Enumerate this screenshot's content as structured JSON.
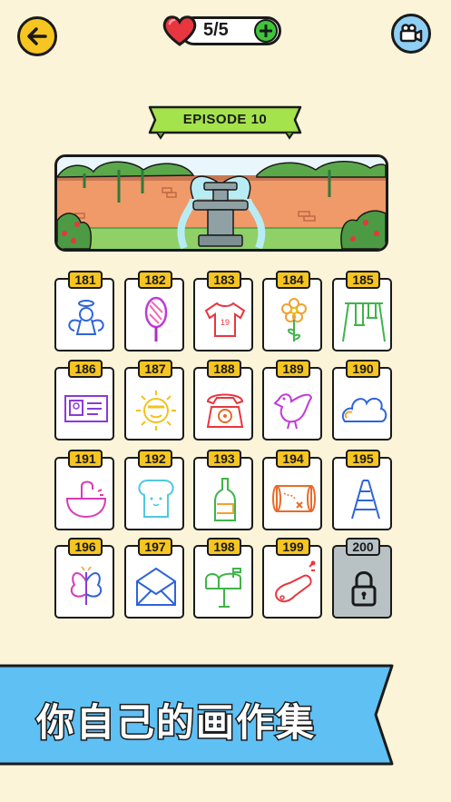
{
  "header": {
    "lives_text": "5/5",
    "lives_current": 5,
    "lives_max": 5
  },
  "episode": {
    "label": "EPISODE 10"
  },
  "levels": [
    {
      "number": "181",
      "icon": "angel-icon",
      "locked": false
    },
    {
      "number": "182",
      "icon": "popsicle-icon",
      "locked": false
    },
    {
      "number": "183",
      "icon": "tshirt-icon",
      "locked": false
    },
    {
      "number": "184",
      "icon": "flower-icon",
      "locked": false
    },
    {
      "number": "185",
      "icon": "swing-icon",
      "locked": false
    },
    {
      "number": "186",
      "icon": "id-card-icon",
      "locked": false
    },
    {
      "number": "187",
      "icon": "sun-icon",
      "locked": false
    },
    {
      "number": "188",
      "icon": "telephone-icon",
      "locked": false
    },
    {
      "number": "189",
      "icon": "bird-icon",
      "locked": false
    },
    {
      "number": "190",
      "icon": "cloud-icon",
      "locked": false
    },
    {
      "number": "191",
      "icon": "sink-icon",
      "locked": false
    },
    {
      "number": "192",
      "icon": "toast-icon",
      "locked": false
    },
    {
      "number": "193",
      "icon": "bottle-icon",
      "locked": false
    },
    {
      "number": "194",
      "icon": "treasure-map-icon",
      "locked": false
    },
    {
      "number": "195",
      "icon": "ladder-icon",
      "locked": false
    },
    {
      "number": "196",
      "icon": "butterfly-icon",
      "locked": false
    },
    {
      "number": "197",
      "icon": "envelope-icon",
      "locked": false
    },
    {
      "number": "198",
      "icon": "mailbox-icon",
      "locked": false
    },
    {
      "number": "199",
      "icon": "sausage-icon",
      "locked": false
    },
    {
      "number": "200",
      "icon": "lock-icon",
      "locked": true
    }
  ],
  "footer": {
    "caption": "你自己的画作集"
  },
  "colors": {
    "background": "#fbf4d8",
    "accent_yellow": "#f6c521",
    "ribbon_green": "#a4e34c",
    "footer_blue": "#5fc0f4",
    "heart_red": "#e8363e",
    "plus_green": "#3fc53a",
    "locked_gray": "#b8c2c4"
  }
}
